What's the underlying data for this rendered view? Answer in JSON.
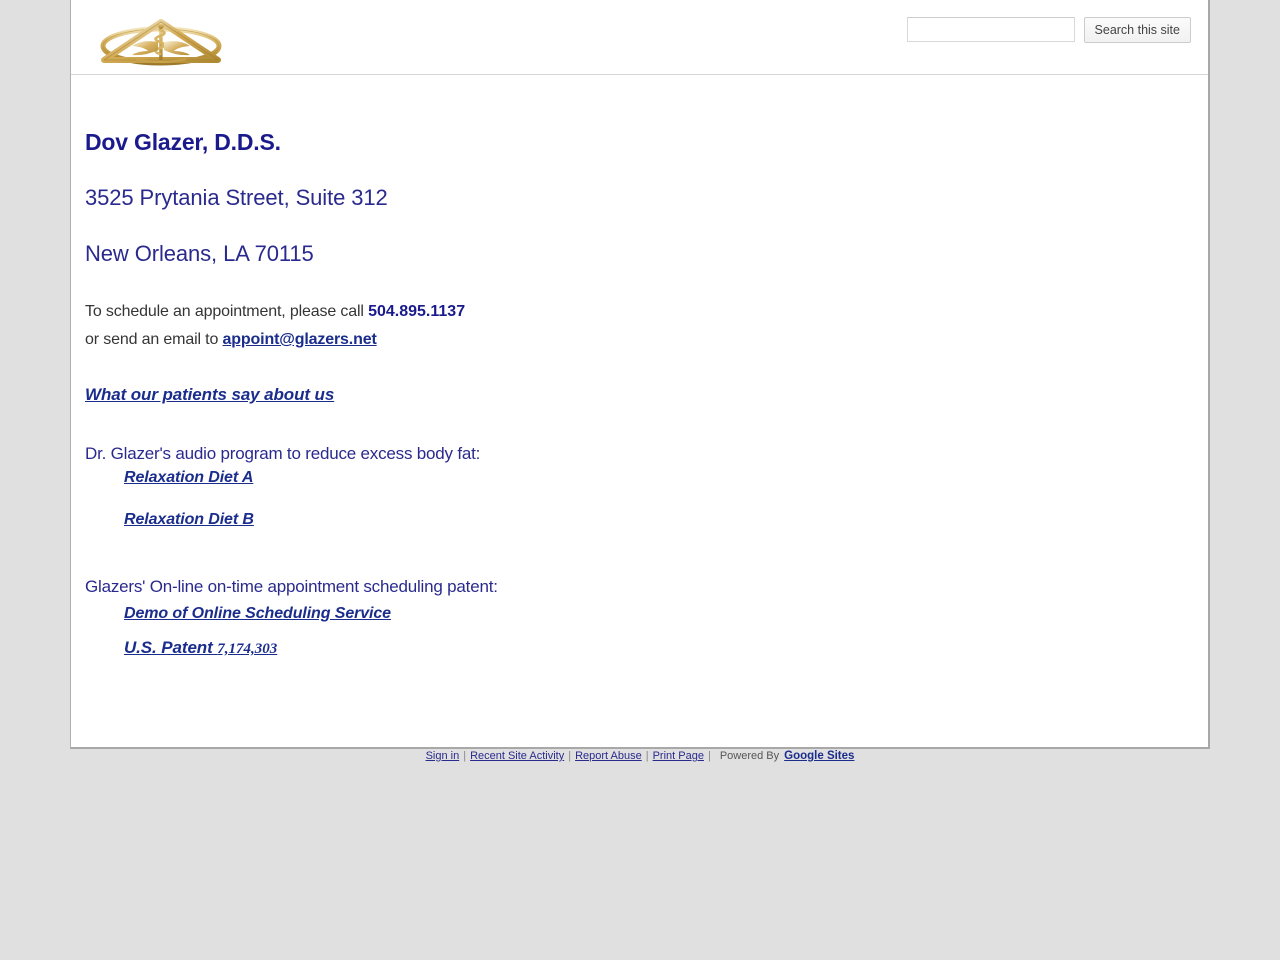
{
  "header": {
    "logo_alt": "dental-caduceus-emblem",
    "logo_colors": {
      "gold_light": "#e8d49a",
      "gold_mid": "#c9a54e",
      "gold_dark": "#a8842f",
      "gold_highlight": "#f6eed2"
    },
    "search": {
      "input_value": "",
      "input_placeholder": "",
      "button_label": "Search this site"
    }
  },
  "main": {
    "practice_name": "Dov Glazer, D.D.S.",
    "address_street": "3525 Prytania Street, Suite 312",
    "address_city": "New Orleans, LA 70115",
    "schedule_text_before": "To schedule an appointment, please call ",
    "phone": "504.895.1137",
    "email_text_before": "or send an email to ",
    "email": "appoint@glazers.net",
    "patients_link": "What our patients say about us",
    "audio_heading": "Dr. Glazer's audio program to reduce excess body fat:",
    "diet_a_link": "Relaxation Diet A",
    "diet_b_link": "Relaxation Diet B",
    "patent_heading": "Glazers' On-line on-time appointment scheduling patent:",
    "demo_link": "Demo of Online Scheduling Service",
    "patent_link_label": "U.S. Patent ",
    "patent_number": "7,174,303"
  },
  "footer": {
    "sign_in": "Sign in",
    "recent_activity": "Recent Site Activity",
    "report_abuse": "Report Abuse",
    "print_page": "Print Page",
    "powered_by": "Powered By",
    "google_sites": "Google Sites",
    "separator": "|"
  },
  "colors": {
    "page_background": "#e0e0e0",
    "content_background": "#ffffff",
    "heading_blue": "#1a1a8c",
    "link_blue": "#1a2d8c",
    "body_gray": "#353535"
  }
}
